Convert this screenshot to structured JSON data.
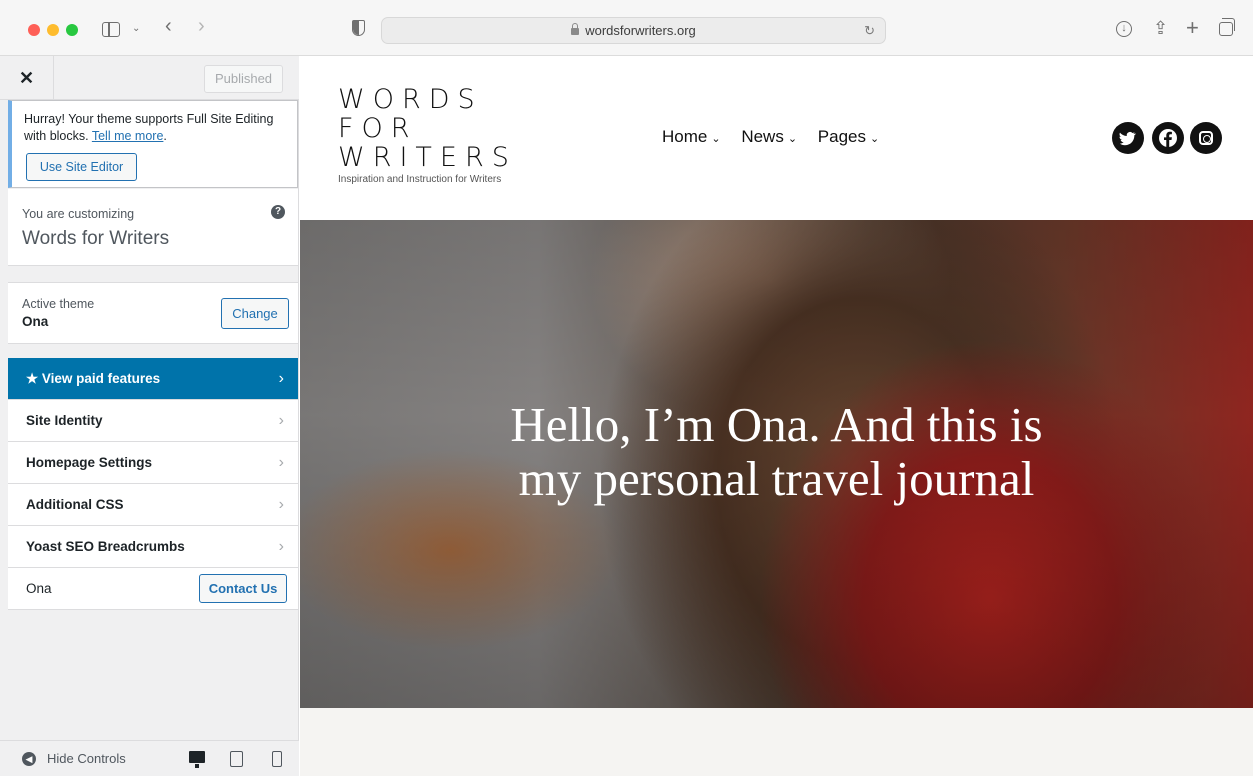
{
  "browser": {
    "url": "wordsforwriters.org"
  },
  "customizer": {
    "published_label": "Published",
    "notice": {
      "text": "Hurray! Your theme supports Full Site Editing with blocks.",
      "link": "Tell me more",
      "button": "Use Site Editor"
    },
    "customizing_label": "You are customizing",
    "site_name": "Words for Writers",
    "active_theme_label": "Active theme",
    "theme_name": "Ona",
    "change_label": "Change",
    "menu": [
      {
        "label": "★ View paid features",
        "highlighted": true
      },
      {
        "label": "Site Identity"
      },
      {
        "label": "Homepage Settings"
      },
      {
        "label": "Additional CSS"
      },
      {
        "label": "Yoast SEO Breadcrumbs"
      }
    ],
    "contact_row": {
      "label": "Ona",
      "button": "Contact Us"
    },
    "hide_controls": "Hide Controls",
    "accent_color": "#0073aa"
  },
  "site": {
    "logo_lines": [
      "WORDS",
      "FOR",
      "WRITERS"
    ],
    "tagline": "Inspiration and Instruction for Writers",
    "nav": [
      "Home",
      "News",
      "Pages"
    ],
    "social_icons": [
      "twitter-icon",
      "facebook-icon",
      "instagram-icon"
    ],
    "hero_line1": "Hello, I’m Ona. And this is",
    "hero_line2": "my personal travel journal"
  }
}
